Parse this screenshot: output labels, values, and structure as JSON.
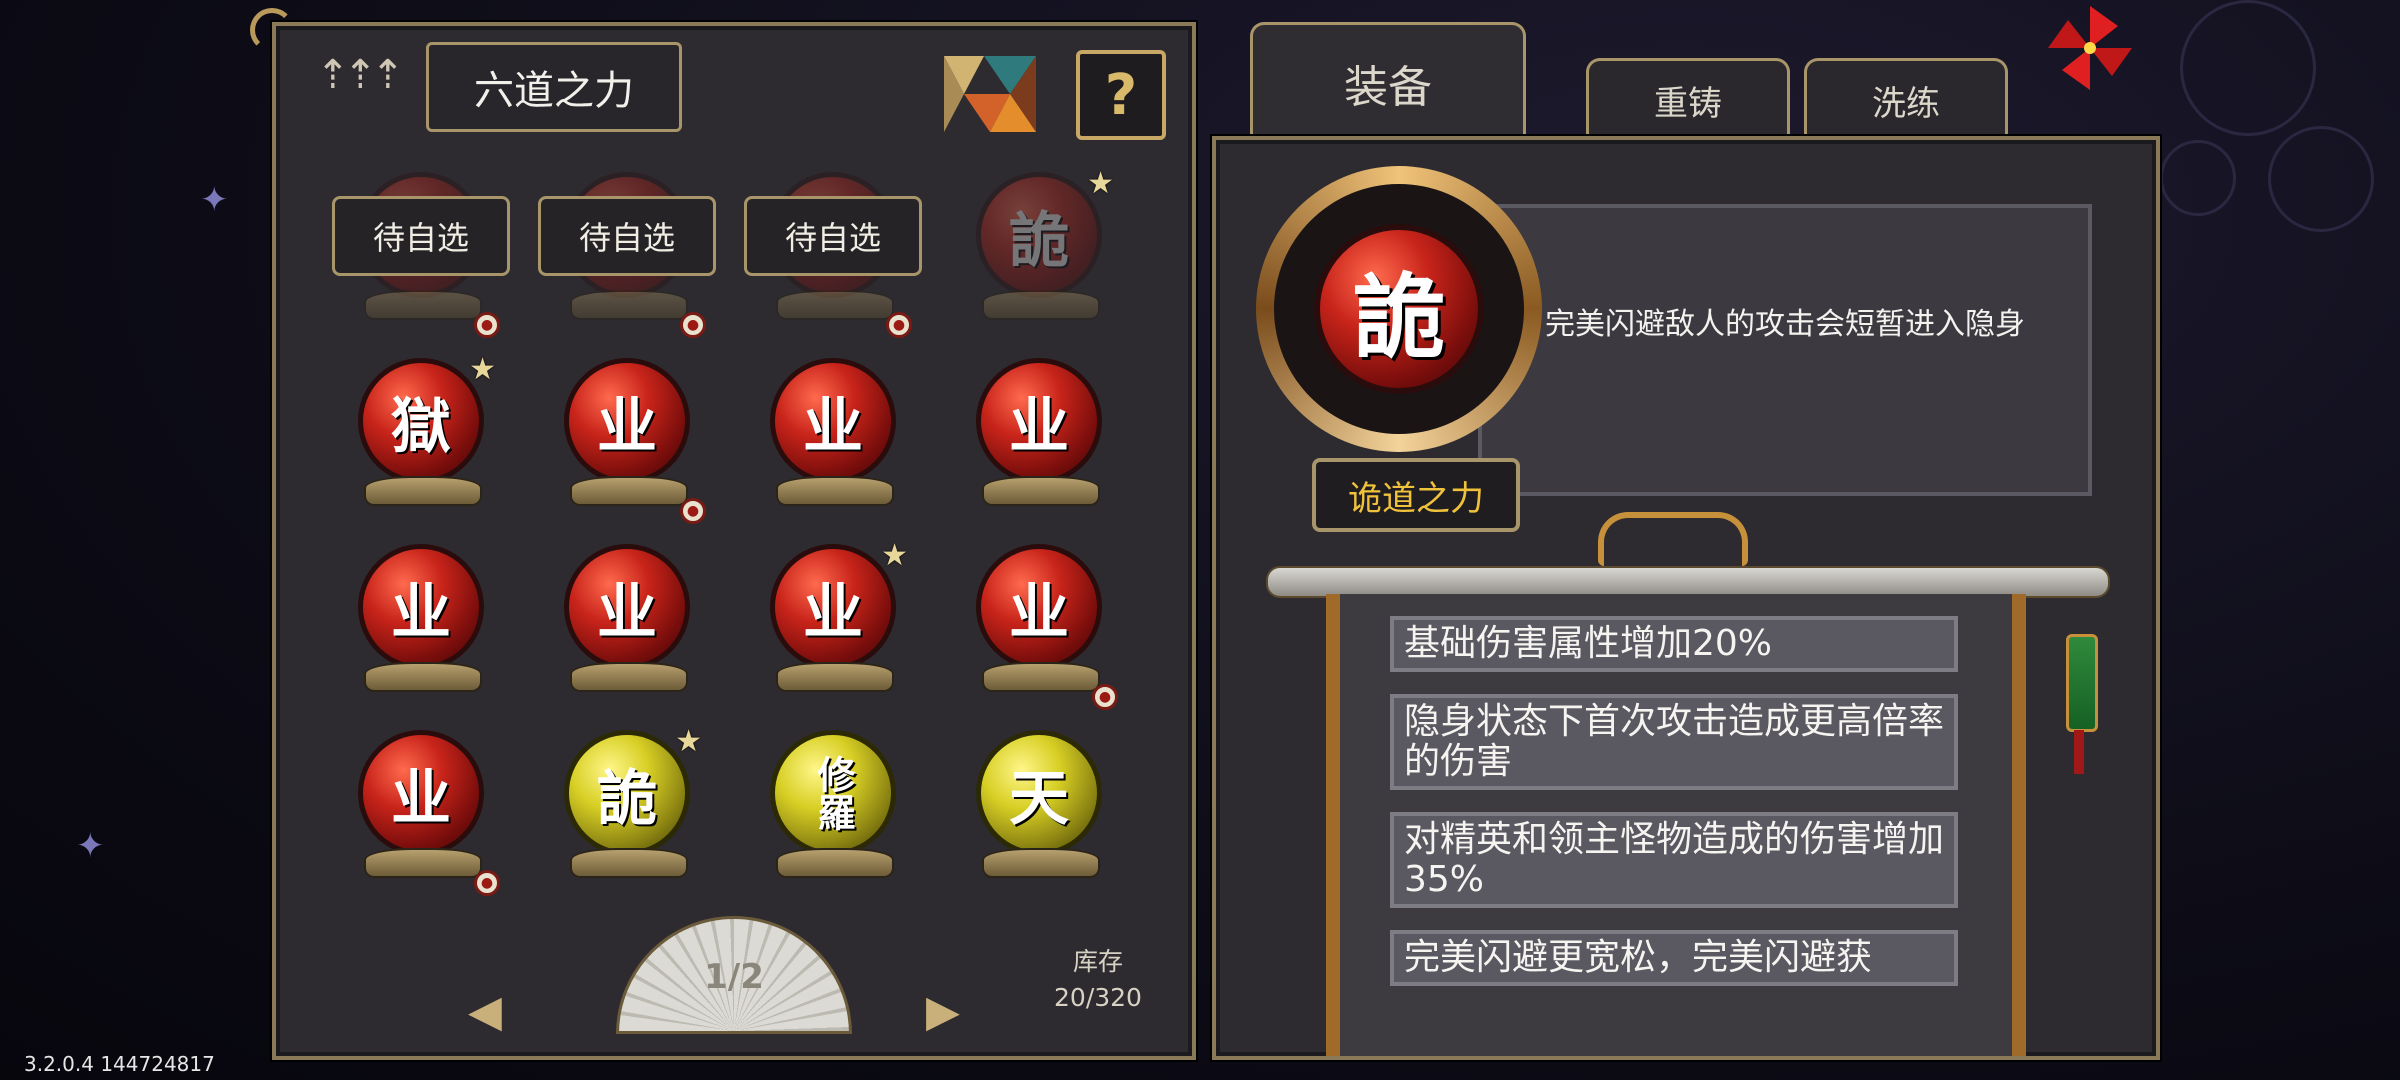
{
  "left_panel": {
    "title": "六道之力",
    "help_label": "?",
    "pending_label": "待自选",
    "slots": [
      {
        "kind": "pending",
        "coin": true
      },
      {
        "kind": "pending",
        "coin": true
      },
      {
        "kind": "pending",
        "coin": true
      },
      {
        "kind": "orb",
        "glyph": "詭",
        "color": "red",
        "dim": true,
        "star": true,
        "coin": false
      },
      {
        "kind": "orb",
        "glyph": "獄",
        "color": "red",
        "dim": false,
        "star": true,
        "coin": false
      },
      {
        "kind": "orb",
        "glyph": "业",
        "color": "red",
        "dim": false,
        "star": false,
        "coin": true
      },
      {
        "kind": "orb",
        "glyph": "业",
        "color": "red",
        "dim": false,
        "star": false,
        "coin": false
      },
      {
        "kind": "orb",
        "glyph": "业",
        "color": "red",
        "dim": false,
        "star": false,
        "coin": false
      },
      {
        "kind": "orb",
        "glyph": "业",
        "color": "red",
        "dim": false,
        "star": false,
        "coin": false
      },
      {
        "kind": "orb",
        "glyph": "业",
        "color": "red",
        "dim": false,
        "star": false,
        "coin": false
      },
      {
        "kind": "orb",
        "glyph": "业",
        "color": "red",
        "dim": false,
        "star": true,
        "coin": false
      },
      {
        "kind": "orb",
        "glyph": "业",
        "color": "red",
        "dim": false,
        "star": false,
        "coin": true
      },
      {
        "kind": "orb",
        "glyph": "业",
        "color": "red",
        "dim": false,
        "star": false,
        "coin": true
      },
      {
        "kind": "orb",
        "glyph": "詭",
        "color": "gold",
        "dim": false,
        "star": true,
        "coin": false
      },
      {
        "kind": "orb",
        "glyph": "修羅",
        "color": "gold",
        "dim": false,
        "star": false,
        "coin": false
      },
      {
        "kind": "orb",
        "glyph": "天",
        "color": "gold",
        "dim": false,
        "star": false,
        "coin": false
      }
    ],
    "page_indicator": "1/2",
    "stock_label": "库存",
    "stock_value": "20/320"
  },
  "tabs": {
    "equip": "装备",
    "recast": "重铸",
    "refine": "洗练"
  },
  "detail": {
    "glyph": "詭",
    "description": "完美闪避敌人的攻击会短暂进入隐身",
    "name": "诡道之力",
    "attributes": [
      "基础伤害属性增加20%",
      "隐身状态下首次攻击造成更高倍率的伤害",
      "对精英和领主怪物造成的伤害增加35%",
      "完美闪避更宽松，完美闪避获"
    ]
  },
  "version": "3.2.0.4 144724817",
  "colors": {
    "accent_gold": "#c7a865",
    "name_yellow": "#f0c23c",
    "orb_red": "#c8241a",
    "orb_gold": "#d7cf24"
  }
}
